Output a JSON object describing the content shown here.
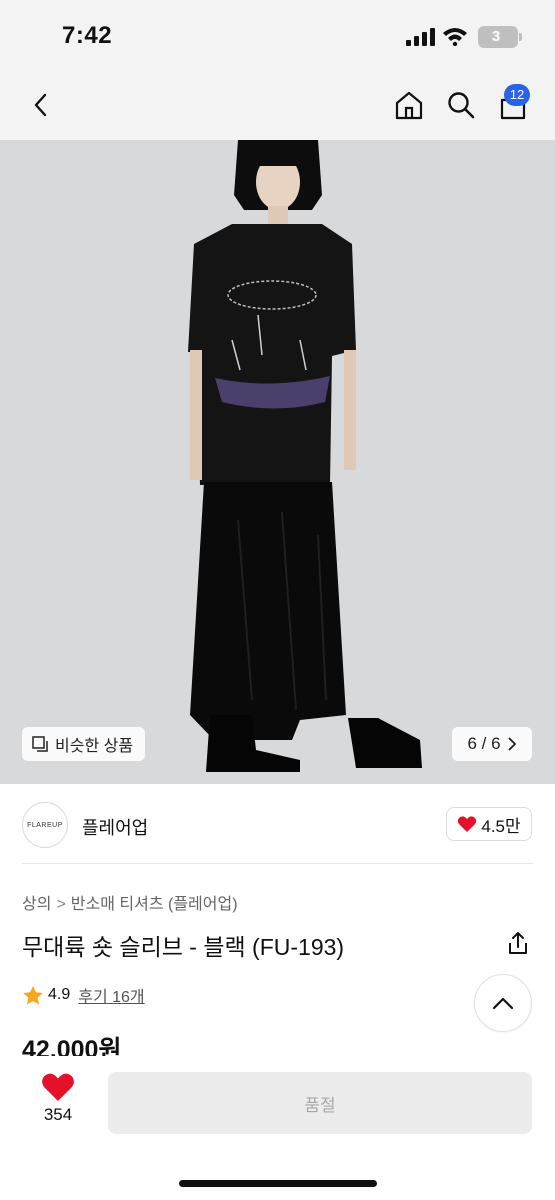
{
  "status_bar": {
    "time": "7:42",
    "battery": "3"
  },
  "nav": {
    "cart_count": "12",
    "icons": [
      "back-icon",
      "home-icon",
      "search-icon",
      "cart-icon"
    ]
  },
  "gallery": {
    "similar_label": "비슷한 상품",
    "counter": "6 / 6",
    "image_background": "#d9dadc"
  },
  "brand": {
    "logo_text": "FLAREUP",
    "name": "플레어업",
    "likes": "4.5만"
  },
  "breadcrumb": [
    "상의",
    "반소매 티셔츠 (플레어업)"
  ],
  "product": {
    "title": "무대륙 숏 슬리브 - 블랙 (FU-193)",
    "rating": "4.9",
    "reviews": "후기 16개",
    "price": "42,000원"
  },
  "bottom_bar": {
    "wish_count": "354",
    "soldout_label": "품절"
  },
  "colors": {
    "heart": "#e5102a",
    "star": "#f5a623",
    "badge": "#2a63e6",
    "disabled_button": "#ececec"
  }
}
